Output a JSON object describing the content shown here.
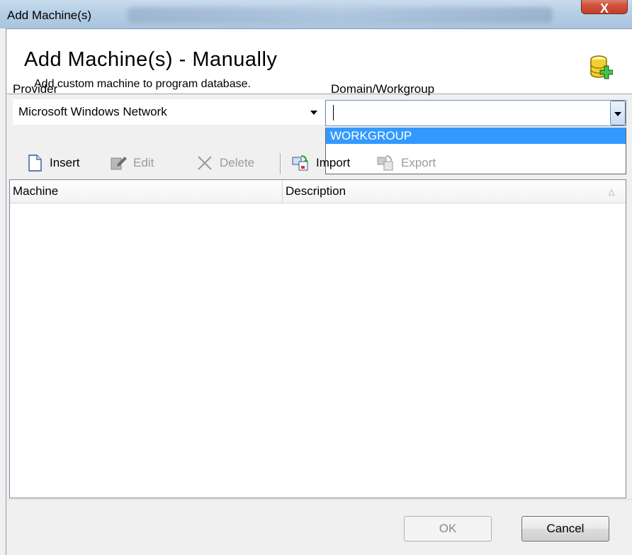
{
  "window": {
    "title": "Add Machine(s)",
    "close_glyph": "X"
  },
  "header": {
    "title": "Add Machine(s) - Manually",
    "subtitle": "Add custom machine to program database.",
    "icon": "database-add-icon"
  },
  "provider": {
    "label": "Provider",
    "value": "Microsoft Windows Network"
  },
  "domain": {
    "label": "Domain/Workgroup",
    "value": "",
    "options": [
      "WORKGROUP"
    ],
    "highlighted": "WORKGROUP"
  },
  "toolbar": {
    "insert": "Insert",
    "edit": "Edit",
    "delete": "Delete",
    "import": "Import",
    "export": "Export"
  },
  "grid": {
    "columns": [
      "Machine",
      "Description"
    ],
    "rows": []
  },
  "buttons": {
    "ok": "OK",
    "cancel": "Cancel"
  },
  "colors": {
    "selection": "#3399ff",
    "close": "#c3402b",
    "disabled_text": "#9a9a9a"
  }
}
